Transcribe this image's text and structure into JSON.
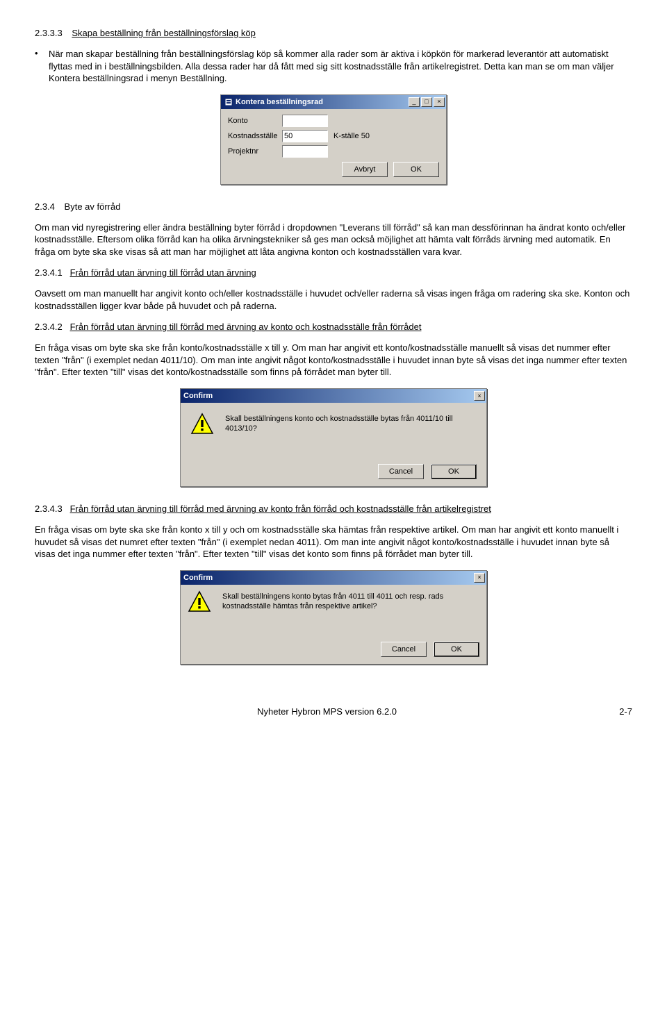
{
  "s1": {
    "num": "2.3.3.3",
    "title": "Skapa beställning från beställningsförslag köp",
    "bullet": "När man skapar beställning från beställningsförslag köp så kommer alla rader som är aktiva i köpkön för markerad leverantör att automatiskt flyttas med in i beställningsbilden. Alla dessa rader har då fått med sig sitt kostnadsställe från artikelregistret. Detta kan man se om man väljer Kontera beställningsrad i menyn Beställning."
  },
  "dlg1": {
    "title": "Kontera beställningsrad",
    "lbl_konto": "Konto",
    "lbl_kst": "Kostnadsställe",
    "lbl_proj": "Projektnr",
    "val_kst": "50",
    "val_kst_name": "K-ställe 50",
    "btn_cancel": "Avbryt",
    "btn_ok": "OK"
  },
  "s2": {
    "num": "2.3.4",
    "title": "Byte av förråd",
    "p1": "Om man vid nyregistrering eller ändra beställning byter förråd i dropdownen \"Leverans till förråd\" så kan man dessförinnan ha ändrat konto och/eller kostnadsställe. Eftersom olika förråd kan ha olika ärvningstekniker så ges man också möjlighet att hämta valt förråds ärvning med automatik. En fråga om byte ska ske visas så att man har möjlighet att låta angivna konton och kostnadsställen vara kvar."
  },
  "s3": {
    "num": "2.3.4.1",
    "title": "Från förråd utan ärvning till förråd utan ärvning",
    "p1": "Oavsett om man manuellt har angivit konto och/eller kostnadsställe i huvudet och/eller raderna så visas ingen fråga om radering ska ske. Konton och kostnadsställen ligger kvar både på huvudet och på raderna."
  },
  "s4": {
    "num": "2.3.4.2",
    "title": "Från förråd utan ärvning till förråd med ärvning av konto och kostnadsställe från förrådet",
    "p1": "En fråga visas om byte ska ske från konto/kostnadsställe x till y. Om man har angivit ett konto/kostnadsställe manuellt så visas det nummer efter texten \"från\" (i exemplet nedan 4011/10). Om man inte angivit något konto/kostnadsställe i huvudet innan byte så visas det inga nummer efter texten \"från\". Efter texten \"till\" visas det konto/kostnadsställe som finns på förrådet man byter till."
  },
  "dlg2": {
    "title": "Confirm",
    "msg": "Skall beställningens konto och kostnadsställe bytas från 4011/10 till 4013/10?",
    "btn_cancel": "Cancel",
    "btn_ok": "OK"
  },
  "s5": {
    "num": "2.3.4.3",
    "title": "Från förråd utan ärvning till förråd med ärvning av konto från förråd och kostnadsställe från artikelregistret",
    "p1": "En fråga visas om byte ska ske från konto x till y och om kostnadsställe ska hämtas från respektive artikel. Om man har angivit ett konto manuellt i huvudet så visas det numret efter texten \"från\" (i exemplet nedan 4011). Om man inte angivit något konto/kostnadsställe i huvudet innan byte så visas det inga nummer efter texten \"från\". Efter texten \"till\" visas det konto som finns på förrådet man byter till."
  },
  "dlg3": {
    "title": "Confirm",
    "msg": "Skall beställningens konto bytas från 4011 till 4011 och resp. rads kostnadsställe hämtas från respektive artikel?",
    "btn_cancel": "Cancel",
    "btn_ok": "OK"
  },
  "footer": {
    "center": "Nyheter Hybron MPS version 6.2.0",
    "right": "2-7"
  }
}
